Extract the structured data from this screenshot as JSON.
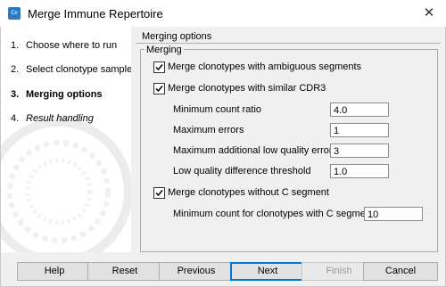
{
  "window": {
    "title": "Merge Immune Repertoire",
    "close_glyph": "✕",
    "icon": "clc-app-icon",
    "icon_text": "Cx"
  },
  "steps": [
    {
      "num": "1.",
      "label": "Choose where to run"
    },
    {
      "num": "2.",
      "label": "Select clonotype samples"
    },
    {
      "num": "3.",
      "label": "Merging options",
      "active": true
    },
    {
      "num": "4.",
      "label": "Result handling"
    }
  ],
  "section": {
    "title": "Merging options",
    "group_title": "Merging"
  },
  "options": {
    "ambiguous": {
      "label": "Merge clonotypes with ambiguous segments",
      "checked": true
    },
    "similar_cdr3": {
      "label": "Merge clonotypes with similar CDR3",
      "checked": true
    },
    "without_c": {
      "label": "Merge clonotypes without C segment",
      "checked": true
    }
  },
  "fields": {
    "min_count_ratio": {
      "label": "Minimum count ratio",
      "value": "4.0"
    },
    "max_errors": {
      "label": "Maximum errors",
      "value": "1"
    },
    "max_low_quality_errors": {
      "label": "Maximum additional low quality errors",
      "value": "3"
    },
    "low_quality_threshold": {
      "label": "Low quality difference threshold",
      "value": "1.0"
    },
    "min_count_c_segment": {
      "label": "Minimum count for clonotypes with C segment",
      "value": "10"
    }
  },
  "buttons": {
    "help": "Help",
    "reset": "Reset",
    "previous": "Previous",
    "next": "Next",
    "finish": "Finish",
    "cancel": "Cancel"
  }
}
